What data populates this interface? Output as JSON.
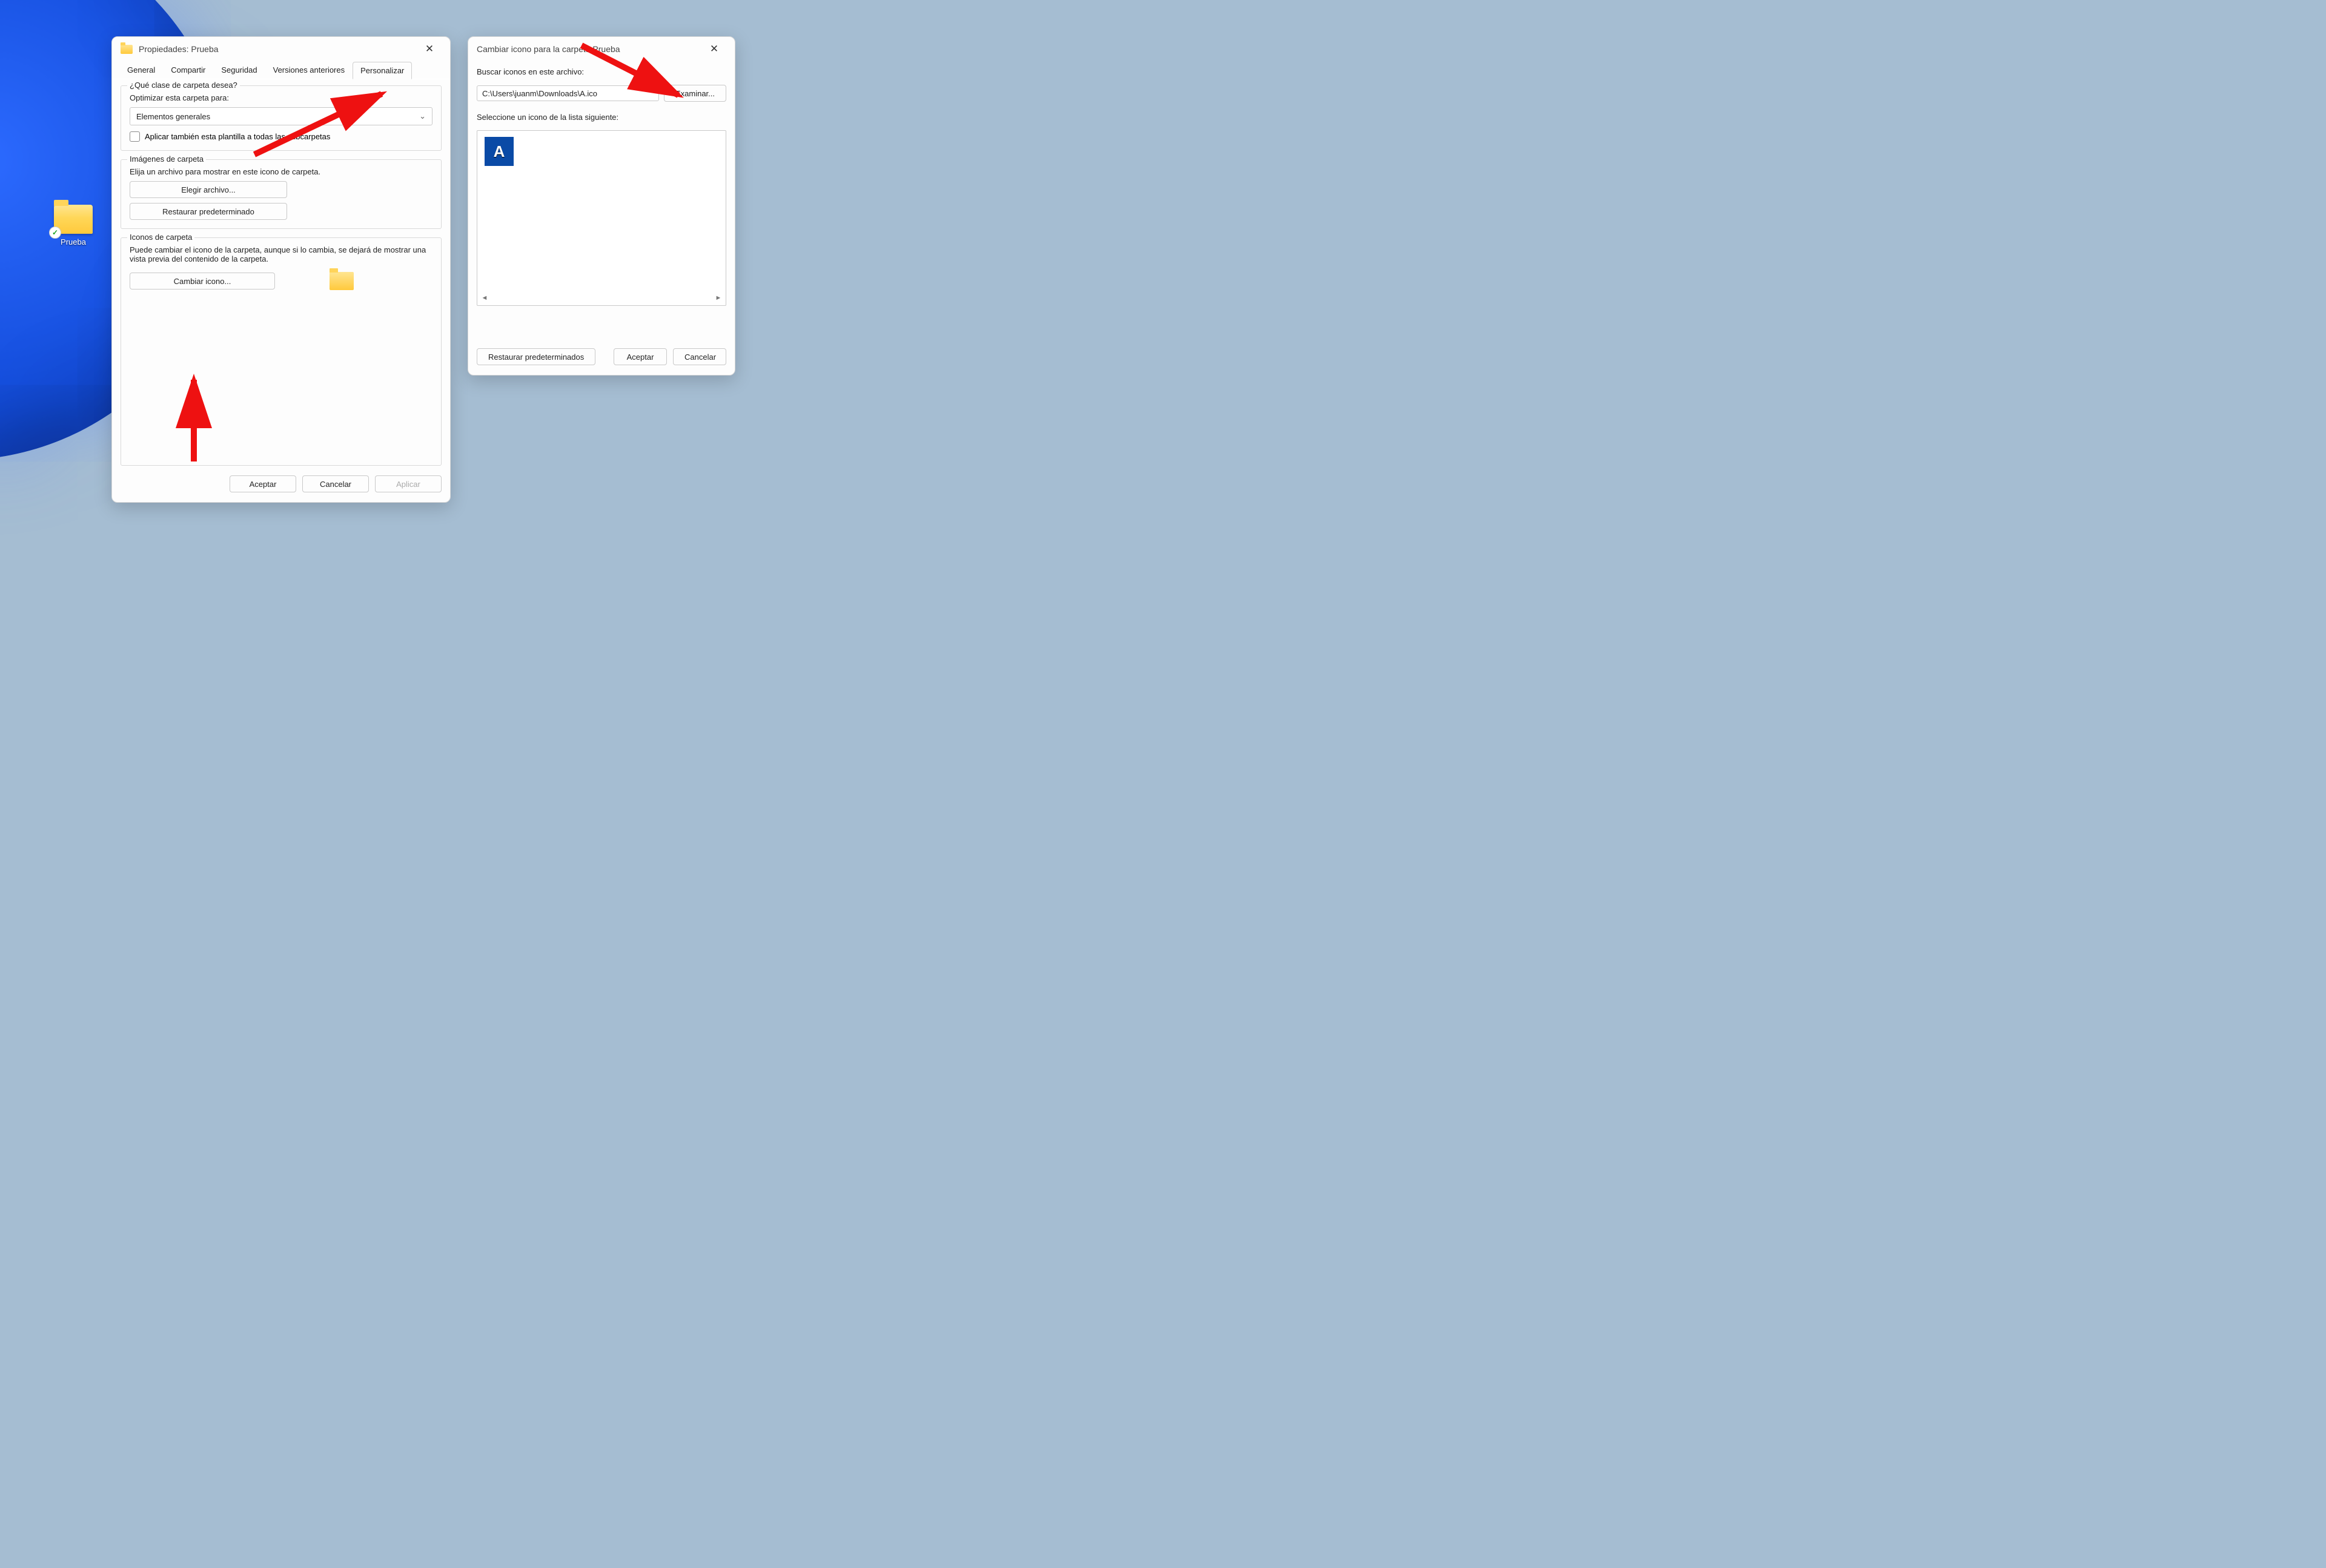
{
  "desktop": {
    "shortcut_label": "Prueba"
  },
  "props_dialog": {
    "title": "Propiedades: Prueba",
    "tabs": {
      "general": "General",
      "share": "Compartir",
      "security": "Seguridad",
      "previous": "Versiones anteriores",
      "customize": "Personalizar"
    },
    "group_folder_kind": {
      "legend": "¿Qué clase de carpeta desea?",
      "optimize_label": "Optimizar esta carpeta para:",
      "optimize_value": "Elementos generales",
      "apply_subfolders": "Aplicar también esta plantilla a todas las subcarpetas"
    },
    "group_folder_images": {
      "legend": "Imágenes de carpeta",
      "description": "Elija un archivo para mostrar en este icono de carpeta.",
      "choose_file": "Elegir archivo...",
      "restore_default": "Restaurar predeterminado"
    },
    "group_folder_icons": {
      "legend": "Iconos de carpeta",
      "description": "Puede cambiar el icono de la carpeta, aunque si lo cambia, se dejará de mostrar una vista previa del contenido de la carpeta.",
      "change_icon": "Cambiar icono..."
    },
    "footer": {
      "accept": "Aceptar",
      "cancel": "Cancelar",
      "apply": "Aplicar"
    }
  },
  "change_icon_dialog": {
    "title": "Cambiar icono para la carpeta Prueba",
    "search_label": "Buscar iconos en este archivo:",
    "file_path": "C:\\Users\\juanm\\Downloads\\A.ico",
    "browse": "Examinar...",
    "select_label": "Seleccione un icono de la lista siguiente:",
    "icon_letter": "A",
    "footer": {
      "restore": "Restaurar predeterminados",
      "accept": "Aceptar",
      "cancel": "Cancelar"
    }
  }
}
